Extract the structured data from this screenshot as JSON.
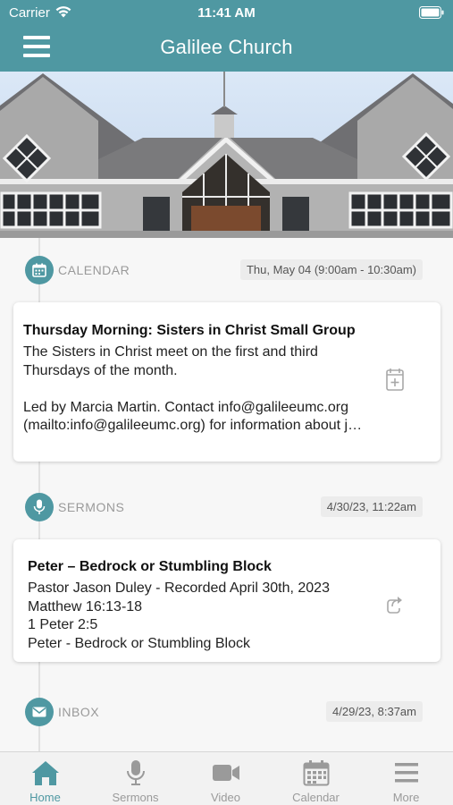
{
  "status_bar": {
    "carrier": "Carrier",
    "time": "11:41 AM"
  },
  "header": {
    "title": "Galilee Church",
    "menu_icon": "hamburger-icon"
  },
  "colors": {
    "accent": "#4f98a2",
    "inactive": "#9a9a9a"
  },
  "feed": {
    "calendar": {
      "label": "CALENDAR",
      "date": "Thu, May 04 (9:00am - 10:30am)",
      "title": "Thursday Morning: Sisters in Christ Small Group",
      "body": "The Sisters in Christ meet on the first and third\nThursdays of the month.\n\nLed by Marcia Martin. Contact info@galileeumc.org\n(mailto:info@galileeumc.org) for information about j…",
      "action_icon": "add-to-calendar-icon"
    },
    "sermons": {
      "label": "SERMONS",
      "date": "4/30/23, 11:22am",
      "title": "Peter – Bedrock or Stumbling Block",
      "body": "Pastor Jason Duley - Recorded April 30th, 2023\nMatthew 16:13-18\n1 Peter 2:5\nPeter - Bedrock or Stumbling Block",
      "action_icon": "share-icon"
    },
    "inbox": {
      "label": "INBOX",
      "date": "4/29/23, 8:37am"
    }
  },
  "tabs": [
    {
      "label": "Home",
      "icon": "home-icon",
      "active": true
    },
    {
      "label": "Sermons",
      "icon": "microphone-icon",
      "active": false
    },
    {
      "label": "Video",
      "icon": "video-camera-icon",
      "active": false
    },
    {
      "label": "Calendar",
      "icon": "calendar-icon",
      "active": false
    },
    {
      "label": "More",
      "icon": "more-lines-icon",
      "active": false
    }
  ]
}
